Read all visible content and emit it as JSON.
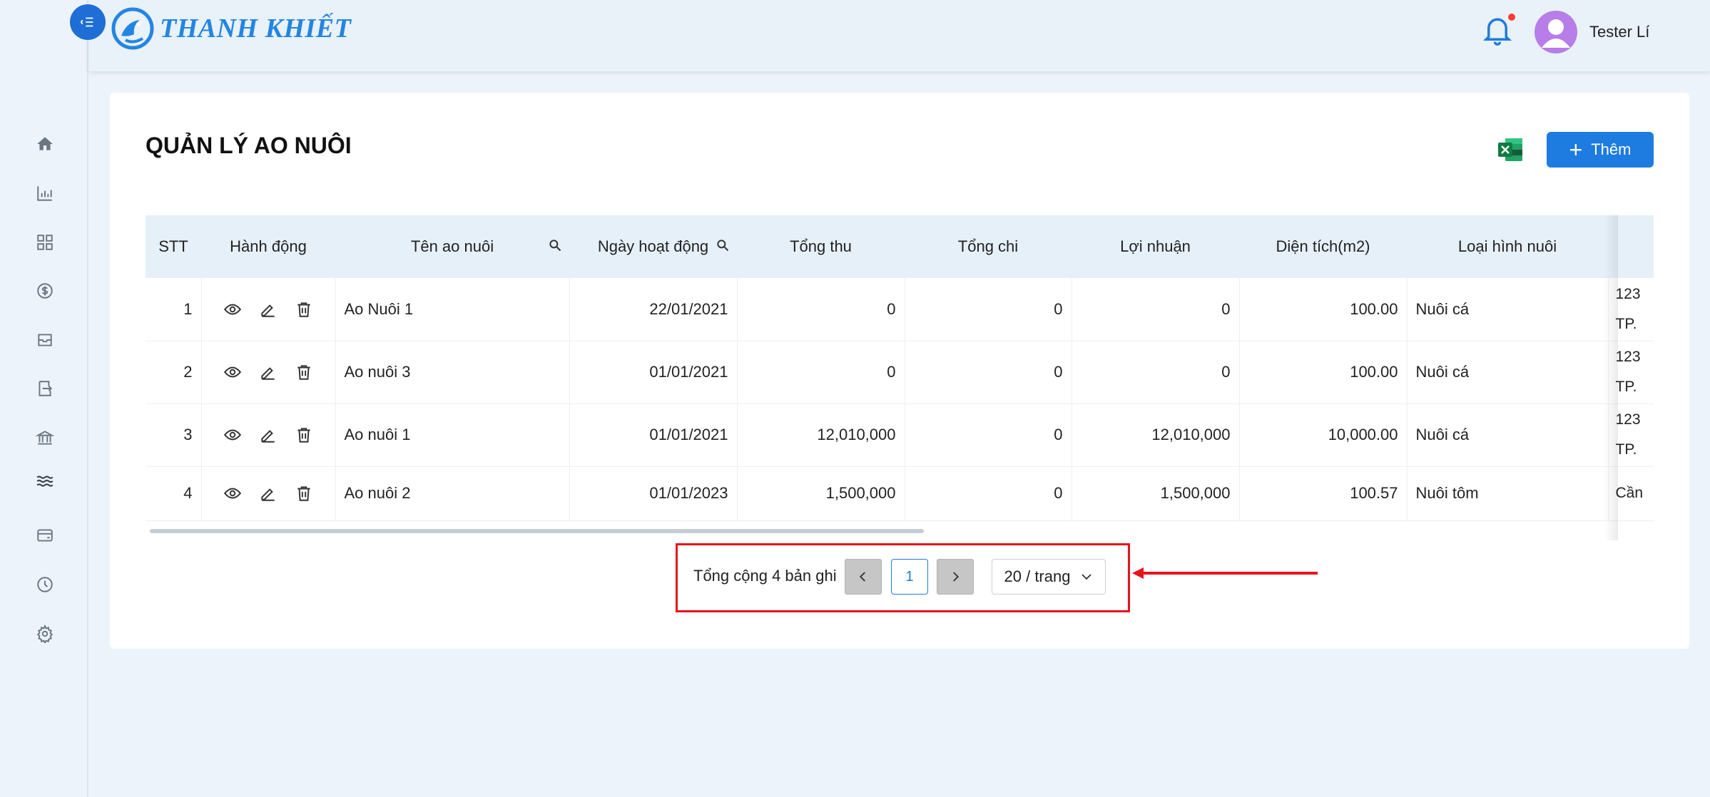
{
  "brand": {
    "name": "THANH KHIẾT"
  },
  "header": {
    "user_name": "Tester Lí"
  },
  "sidebar": {
    "items": [
      {
        "icon": "home-icon"
      },
      {
        "icon": "bar-chart-icon"
      },
      {
        "icon": "dashboard-grid-icon"
      },
      {
        "icon": "dollar-icon"
      },
      {
        "icon": "inbox-icon"
      },
      {
        "icon": "receipt-icon"
      },
      {
        "icon": "bank-icon"
      },
      {
        "icon": "waves-icon"
      },
      {
        "icon": "credit-card-icon"
      },
      {
        "icon": "clock-icon"
      },
      {
        "icon": "gear-icon"
      }
    ]
  },
  "page": {
    "title": "QUẢN LÝ AO NUÔI",
    "add_label": "Thêm"
  },
  "table": {
    "columns": [
      "STT",
      "Hành động",
      "Tên ao nuôi",
      "Ngày hoạt động",
      "Tổng thu",
      "Tổng chi",
      "Lợi nhuận",
      "Diện tích(m2)",
      "Loại hình nuôi"
    ],
    "rows": [
      {
        "stt": "1",
        "name": "Ao Nuôi 1",
        "date": "22/01/2021",
        "revenue": "0",
        "expense": "0",
        "profit": "0",
        "area": "100.00",
        "type": "Nuôi cá",
        "addr1": "123",
        "addr2": "TP."
      },
      {
        "stt": "2",
        "name": "Ao nuôi 3",
        "date": "01/01/2021",
        "revenue": "0",
        "expense": "0",
        "profit": "0",
        "area": "100.00",
        "type": "Nuôi cá",
        "addr1": "123",
        "addr2": "TP."
      },
      {
        "stt": "3",
        "name": "Ao nuôi 1",
        "date": "01/01/2021",
        "revenue": "12,010,000",
        "expense": "0",
        "profit": "12,010,000",
        "area": "10,000.00",
        "type": "Nuôi cá",
        "addr1": "123",
        "addr2": "TP."
      },
      {
        "stt": "4",
        "name": "Ao nuôi 2",
        "date": "01/01/2023",
        "revenue": "1,500,000",
        "expense": "0",
        "profit": "1,500,000",
        "area": "100.57",
        "type": "Nuôi tôm",
        "addr1": "Cần",
        "addr2": ""
      }
    ]
  },
  "pagination": {
    "total_text": "Tổng cộng 4 bản ghi",
    "current_page": "1",
    "page_size": "20 / trang"
  },
  "colors": {
    "primary": "#1e7be0",
    "highlight_box": "#e8141b",
    "header_bg": "#e6f0f9"
  }
}
